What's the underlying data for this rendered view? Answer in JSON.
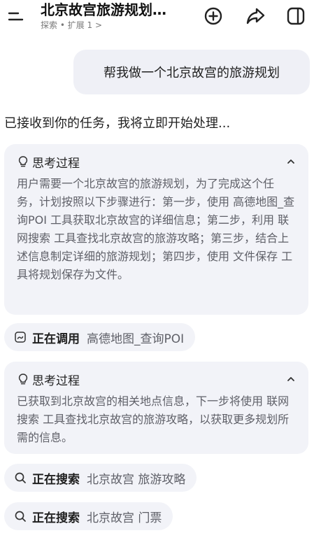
{
  "header": {
    "title": "北京故宫旅游规划…",
    "subtitle": "探索 • 扩展 1 >",
    "icons": [
      "menu-icon",
      "new-chat-icon",
      "share-icon",
      "sidebar-icon"
    ]
  },
  "conversation": {
    "user_message": "帮我做一个北京故宫的旅游规划",
    "ack": "已接收到你的任务，我将立即开始处理..."
  },
  "thinking_1": {
    "title": "思考过程",
    "body": "用户需要一个北京故宫的旅游规划，为了完成这个任务，计划按照以下步骤进行：第一步，使用 高德地图_查询POI 工具获取北京故宫的详细信息；第二步，利用 联网搜索 工具查找北京故宫的旅游攻略；第三步，结合上述信息制定详细的旅游规划；第四步，使用 文件保存 工具将规划保存为文件。"
  },
  "tool_call": {
    "label": "正在调用",
    "query": "高德地图_查询POI"
  },
  "thinking_2": {
    "title": "思考过程",
    "body": "已获取到北京故宫的相关地点信息，下一步将使用 联网搜索 工具查找北京故宫的旅游攻略，以获取更多规划所需的信息。"
  },
  "search_1": {
    "label": "正在搜索",
    "query": "北京故宫 旅游攻略"
  },
  "search_2": {
    "label": "正在搜索",
    "query": "北京故宫 门票"
  },
  "colors": {
    "bubble_bg": "#eff0f6",
    "card_bg": "#f2f3f8",
    "muted_text": "#5f6068"
  }
}
